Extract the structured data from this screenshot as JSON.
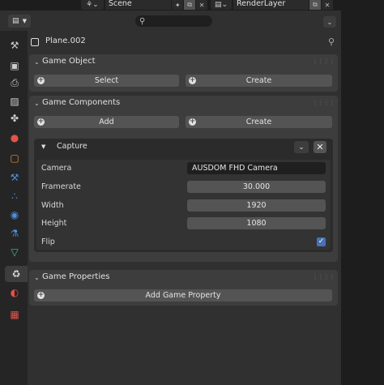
{
  "topbar": {
    "scene": {
      "icon": "scene-icon",
      "label": "Scene"
    },
    "render_layer": {
      "icon": "render-layer-icon",
      "label": "RenderLayer"
    }
  },
  "header": {
    "editor_type_icon": "properties-editor-icon",
    "search_icon": "search-icon",
    "search_placeholder": ""
  },
  "object": {
    "name": "Plane.002",
    "icon": "object-icon"
  },
  "tabs": [
    {
      "name": "tool-tab",
      "icon": "tool-icon",
      "glyph": "⚒",
      "color": "#cccccc"
    },
    {
      "name": "render-tab",
      "icon": "render-icon",
      "glyph": "▣",
      "color": "#cccccc"
    },
    {
      "name": "output-tab",
      "icon": "printer-icon",
      "glyph": "⎙",
      "color": "#cccccc"
    },
    {
      "name": "view-layer-tab",
      "icon": "image-icon",
      "glyph": "▨",
      "color": "#cccccc"
    },
    {
      "name": "scene-tab",
      "icon": "scene-icon",
      "glyph": "✤",
      "color": "#cccccc"
    },
    {
      "name": "world-tab",
      "icon": "world-icon",
      "glyph": "●",
      "color": "#e2534b"
    },
    {
      "name": "object-tab",
      "icon": "object-icon",
      "glyph": "▢",
      "color": "#f08a3a"
    },
    {
      "name": "modifier-tab",
      "icon": "wrench-icon",
      "glyph": "⚒",
      "color": "#4c8ed9"
    },
    {
      "name": "particles-tab",
      "icon": "particles-icon",
      "glyph": "∴",
      "color": "#4c8ed9"
    },
    {
      "name": "physics-tab",
      "icon": "physics-icon",
      "glyph": "◉",
      "color": "#4c8ed9"
    },
    {
      "name": "constraints-tab",
      "icon": "constraint-icon",
      "glyph": "⚗",
      "color": "#4c8ed9"
    },
    {
      "name": "data-tab",
      "icon": "mesh-data-icon",
      "glyph": "▽",
      "color": "#44c08a"
    },
    {
      "name": "game-tab",
      "icon": "game-components-icon",
      "glyph": "♻",
      "color": "#dddddd"
    },
    {
      "name": "material-tab",
      "icon": "material-icon",
      "glyph": "◐",
      "color": "#e2534b"
    },
    {
      "name": "texture-tab",
      "icon": "texture-icon",
      "glyph": "▦",
      "color": "#e2534b"
    }
  ],
  "game_object": {
    "title": "Game Object",
    "select_label": "Select",
    "create_label": "Create"
  },
  "game_components": {
    "title": "Game Components",
    "add_label": "Add",
    "create_label": "Create",
    "component": {
      "title": "Capture",
      "properties": {
        "camera_label": "Camera",
        "camera_value": "AUSDOM FHD Camera",
        "framerate_label": "Framerate",
        "framerate_value": "30.000",
        "width_label": "Width",
        "width_value": "1920",
        "height_label": "Height",
        "height_value": "1080",
        "flip_label": "Flip",
        "flip_checked": true
      }
    }
  },
  "game_properties": {
    "title": "Game Properties",
    "add_label": "Add Game Property"
  },
  "colors": {
    "accent": "#4772b3",
    "panel": "#3d3d3d",
    "background": "#303030"
  }
}
